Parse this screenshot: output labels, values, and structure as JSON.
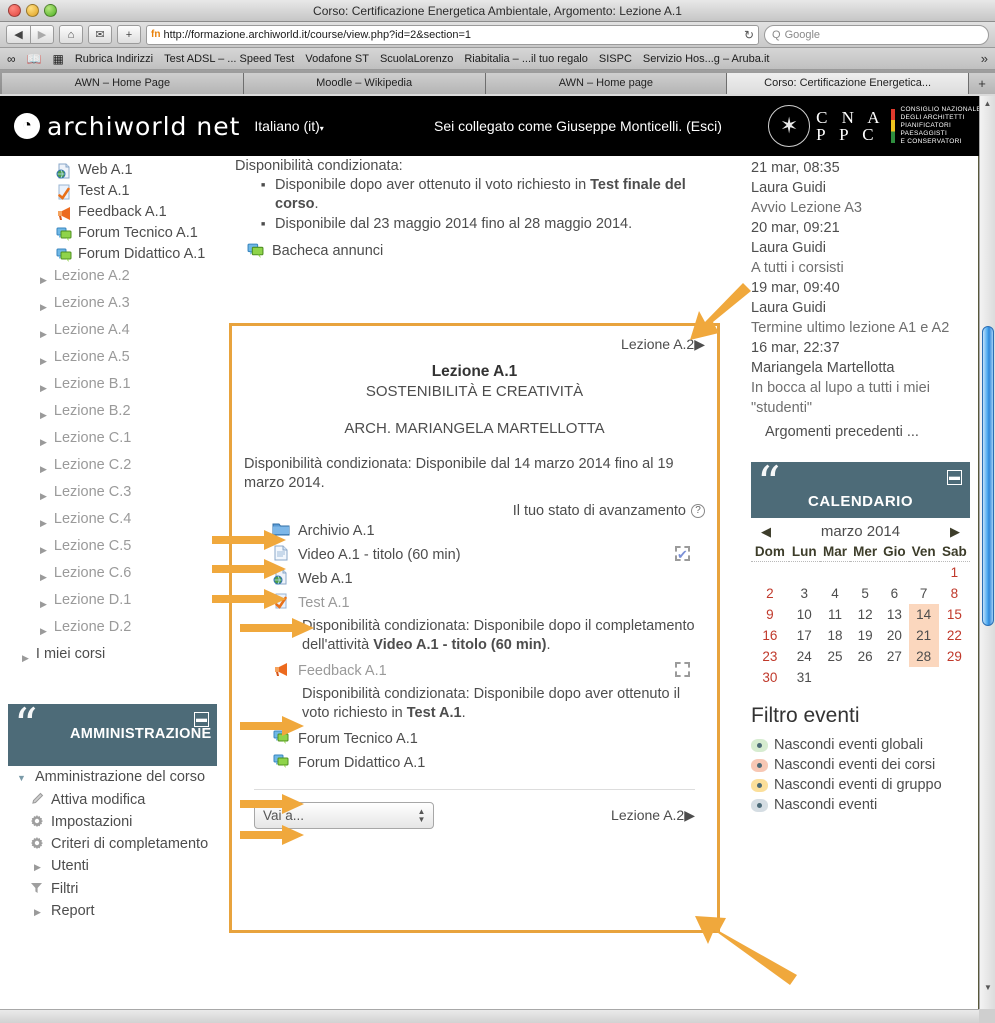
{
  "window": {
    "title": "Corso: Certificazione Energetica Ambientale, Argomento: Lezione A.1"
  },
  "browser": {
    "url": "http://formazione.archiworld.it/course/view.php?id=2&section=1",
    "search_placeholder": "Google",
    "back_icon": "◀",
    "forward_icon": "▶",
    "home_icon": "⌂",
    "mail_icon": "✉",
    "add_icon": "+",
    "reload_icon": "↻",
    "favicon_text": "fn",
    "search_icon": "Q",
    "bookmarks": [
      "Rubrica Indirizzi",
      "Test ADSL – ... Speed Test",
      "Vodafone ST",
      "ScuolaLorenzo",
      "Riabitalia – ...il tuo regalo",
      "SISPC",
      "Servizio Hos...g – Aruba.it"
    ],
    "bookmarks_overflow_icon": "»",
    "tabs": [
      {
        "label": "AWN – Home Page",
        "active": false
      },
      {
        "label": "Moodle – Wikipedia",
        "active": false
      },
      {
        "label": "AWN – Home page",
        "active": false
      },
      {
        "label": "Corso: Certificazione Energetica...",
        "active": true
      }
    ],
    "new_tab_icon": "+"
  },
  "site_header": {
    "logo_text": "archiworld net",
    "logo_mark": "◔",
    "language": "Italiano (it)",
    "language_caret": "▾",
    "login_status": "Sei collegato come Giuseppe Monticelli. (Esci)",
    "cna_letters_line1": "C N A",
    "cna_letters_line2": "P P C",
    "cna_sub": [
      "CONSIGLIO NAZIONALE",
      "DEGLI ARCHITETTI",
      "PIANIFICATORI",
      "PAESAGGISTI",
      "E CONSERVATORI"
    ]
  },
  "left_nav": {
    "leaf_items": [
      {
        "label": "Web A.1",
        "icon": "web-resource-icon"
      },
      {
        "label": "Test A.1",
        "icon": "quiz-icon"
      },
      {
        "label": "Feedback A.1",
        "icon": "feedback-icon"
      },
      {
        "label": "Forum Tecnico A.1",
        "icon": "forum-icon"
      },
      {
        "label": "Forum Didattico A.1",
        "icon": "forum-icon"
      }
    ],
    "lessons": [
      "Lezione A.2",
      "Lezione A.3",
      "Lezione A.4",
      "Lezione A.5",
      "Lezione B.1",
      "Lezione B.2",
      "Lezione C.1",
      "Lezione C.2",
      "Lezione C.3",
      "Lezione C.4",
      "Lezione C.5",
      "Lezione C.6",
      "Lezione D.1",
      "Lezione D.2"
    ],
    "my_courses": "I miei corsi",
    "expand_icon": "▶"
  },
  "admin_block": {
    "title": "AMMINISTRAZIONE",
    "quote_glyph": "“",
    "minimize_icon": "▬",
    "header_label": "Amministrazione del corso",
    "collapse_icon": "▼",
    "items": [
      {
        "label": "Attiva modifica",
        "icon": "pencil-icon"
      },
      {
        "label": "Impostazioni",
        "icon": "gear-icon"
      },
      {
        "label": "Criteri di completamento",
        "icon": "gear-icon"
      },
      {
        "label": "Utenti",
        "icon": "chevron-right-icon"
      },
      {
        "label": "Filtri",
        "icon": "funnel-icon"
      },
      {
        "label": "Report",
        "icon": "chevron-right-icon"
      }
    ]
  },
  "top_content": {
    "availability_heading": "Disponibilità condizionata:",
    "bullets": [
      {
        "pre": "Disponibile dopo aver ottenuto il voto richiesto in ",
        "bold": "Test finale del corso",
        "post": "."
      },
      {
        "pre": "Disponibile dal 23 maggio 2014 fino al 28 maggio 2014.",
        "bold": "",
        "post": ""
      }
    ],
    "bacheca": "Bacheca annunci"
  },
  "section": {
    "next_link": "Lezione A.2",
    "next_arrow": "▶",
    "title": "Lezione A.1",
    "subtitle": "SOSTENIBILITÀ E CREATIVITÀ",
    "author": "ARCH. MARIANGELA MARTELLOTTA",
    "availability": "Disponibilità condizionata: Disponibile dal 14 marzo 2014 fino al 19 marzo 2014.",
    "progress_label": "Il tuo stato di avanzamento",
    "help_icon": "?",
    "activities": [
      {
        "label": "Archivio A.1",
        "icon": "folder-icon",
        "dim": false,
        "checkbox": "none"
      },
      {
        "label": "Video A.1 - titolo (60 min)",
        "icon": "page-icon",
        "dim": false,
        "checkbox": "checked"
      },
      {
        "label": "Web A.1",
        "icon": "web-resource-icon",
        "dim": false,
        "checkbox": "none"
      },
      {
        "label": "Test A.1",
        "icon": "quiz-icon",
        "dim": true,
        "checkbox": "none",
        "condition": {
          "pre": "Disponibilità condizionata: Disponibile dopo il completamento dell'attività ",
          "bold": "Video A.1 - titolo (60 min)",
          "post": "."
        }
      },
      {
        "label": "Feedback A.1",
        "icon": "feedback-icon",
        "dim": true,
        "checkbox": "empty",
        "condition": {
          "pre": "Disponibilità condizionata: Disponibile dopo aver ottenuto il voto richiesto in ",
          "bold": "Test A.1",
          "post": "."
        }
      },
      {
        "label": "Forum Tecnico A.1",
        "icon": "forum-icon",
        "dim": false,
        "checkbox": "none"
      },
      {
        "label": "Forum Didattico A.1",
        "icon": "forum-icon",
        "dim": false,
        "checkbox": "none"
      }
    ],
    "jump_to": "Vai a...",
    "jump_stepper": "▲▼",
    "footer_next_link": "Lezione A.2",
    "footer_next_arrow": "▶"
  },
  "news": {
    "entries": [
      {
        "date": "21 mar, 08:35",
        "author": "Laura Guidi",
        "subject": "Avvio Lezione A3"
      },
      {
        "date": "20 mar, 09:21",
        "author": "Laura Guidi",
        "subject": "A tutti i corsisti"
      },
      {
        "date": "19 mar, 09:40",
        "author": "Laura Guidi",
        "subject": "Termine ultimo lezione A1 e A2"
      },
      {
        "date": "16 mar, 22:37",
        "author": "Mariangela Martellotta",
        "subject": "In bocca al lupo a tutti i miei \"studenti\""
      }
    ],
    "more_link": "Argomenti precedenti ..."
  },
  "calendar": {
    "title": "CALENDARIO",
    "quote_glyph": "“",
    "minimize_icon": "▬",
    "prev_icon": "◀",
    "next_icon": "▶",
    "month_label": "marzo 2014",
    "weekdays": [
      "Dom",
      "Lun",
      "Mar",
      "Mer",
      "Gio",
      "Ven",
      "Sab"
    ],
    "weeks": [
      [
        "",
        "",
        "",
        "",
        "",
        "",
        "1"
      ],
      [
        "2",
        "3",
        "4",
        "5",
        "6",
        "7",
        "8"
      ],
      [
        "9",
        "10",
        "11",
        "12",
        "13",
        "14",
        "15"
      ],
      [
        "16",
        "17",
        "18",
        "19",
        "20",
        "21",
        "22"
      ],
      [
        "23",
        "24",
        "25",
        "26",
        "27",
        "28",
        "29"
      ],
      [
        "30",
        "31",
        "",
        "",
        "",
        "",
        ""
      ]
    ],
    "highlighted_days": [
      "14",
      "21",
      "28"
    ],
    "weekend_columns": [
      0,
      6
    ]
  },
  "event_filter": {
    "title": "Filtro eventi",
    "items": [
      {
        "label": "Nascondi eventi globali",
        "color": "#d6ecd0"
      },
      {
        "label": "Nascondi eventi dei corsi",
        "color": "#f7c7b4"
      },
      {
        "label": "Nascondi eventi di gruppo",
        "color": "#fbdf9a"
      },
      {
        "label": "Nascondi eventi",
        "color": "#d5dde3"
      }
    ]
  },
  "colors": {
    "annotation_orange": "#f0a83c",
    "block_header": "#4d6b78",
    "page_background": "#58583a",
    "calendar_highlight": "#fbd7be"
  }
}
